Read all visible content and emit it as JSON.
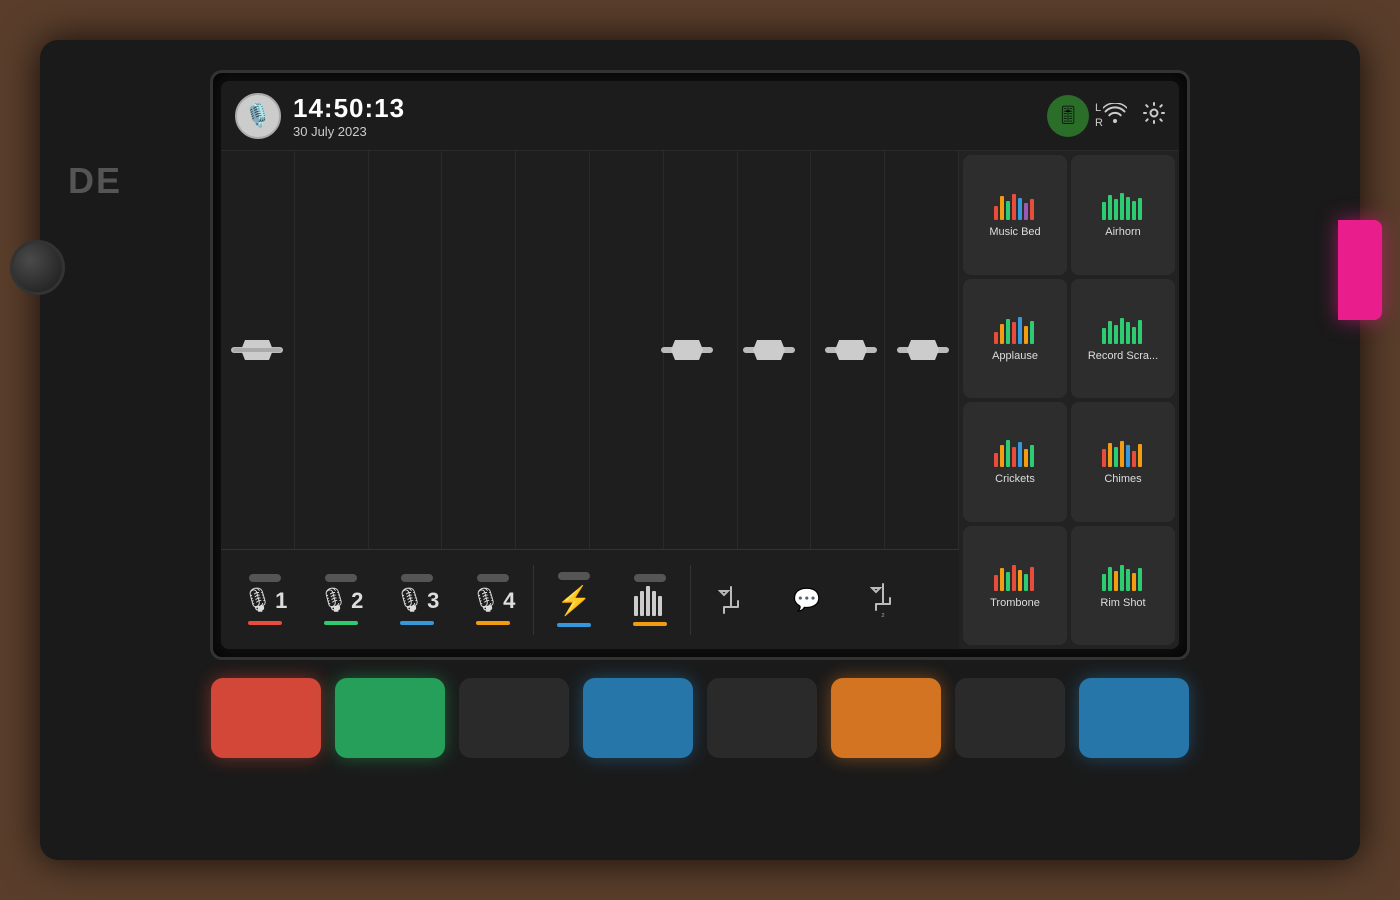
{
  "device": {
    "label": "DE"
  },
  "header": {
    "time": "14:50:13",
    "date": "30 July 2023",
    "avatar_emoji": "🎙️",
    "meter_icon": "🎚️",
    "lr_label": "L\nR",
    "wifi_icon": "wifi",
    "settings_icon": "gear"
  },
  "pads": [
    {
      "id": "music-bed",
      "label": "Music Bed",
      "colors": [
        "#e74c3c",
        "#f39c12",
        "#2ecc71",
        "#e74c3c",
        "#3498db",
        "#9b59b6"
      ]
    },
    {
      "id": "airhorn",
      "label": "Airhorn",
      "colors": [
        "#2ecc71",
        "#2ecc71",
        "#2ecc71",
        "#2ecc71",
        "#2ecc71",
        "#2ecc71"
      ]
    },
    {
      "id": "applause",
      "label": "Applause",
      "colors": [
        "#e74c3c",
        "#f39c12",
        "#2ecc71",
        "#e74c3c",
        "#3498db",
        "#f39c12"
      ]
    },
    {
      "id": "record-scratch",
      "label": "Record Scra...",
      "colors": [
        "#2ecc71",
        "#2ecc71",
        "#2ecc71",
        "#2ecc71",
        "#2ecc71",
        "#2ecc71"
      ]
    },
    {
      "id": "crickets",
      "label": "Crickets",
      "colors": [
        "#e74c3c",
        "#f39c12",
        "#2ecc71",
        "#e74c3c",
        "#3498db",
        "#f39c12"
      ]
    },
    {
      "id": "chimes",
      "label": "Chimes",
      "colors": [
        "#e74c3c",
        "#f39c12",
        "#2ecc71",
        "#f39c12",
        "#3498db",
        "#e74c3c"
      ]
    },
    {
      "id": "trombone",
      "label": "Trombone",
      "colors": [
        "#e74c3c",
        "#f39c12",
        "#2ecc71",
        "#e74c3c",
        "#f39c12",
        "#2ecc71"
      ]
    },
    {
      "id": "rim-shot",
      "label": "Rim Shot",
      "colors": [
        "#2ecc71",
        "#2ecc71",
        "#f39c12",
        "#2ecc71",
        "#2ecc71",
        "#f39c12"
      ]
    }
  ],
  "pad_bar_heights": [
    [
      8,
      14,
      22,
      18,
      12,
      24,
      16,
      10
    ],
    [
      20,
      12,
      8,
      18,
      24,
      10,
      16,
      14
    ],
    [
      10,
      18,
      24,
      14,
      8,
      22,
      12,
      20
    ],
    [
      16,
      8,
      20,
      24,
      12,
      18,
      10,
      22
    ],
    [
      12,
      24,
      16,
      8,
      22,
      14,
      20,
      10
    ],
    [
      18,
      10,
      22,
      16,
      24,
      8,
      14,
      20
    ],
    [
      14,
      20,
      10,
      22,
      16,
      24,
      8,
      18
    ],
    [
      22,
      16,
      8,
      20,
      10,
      18,
      24,
      12
    ]
  ],
  "channels": [
    {
      "id": "mic1",
      "icon": "🎙",
      "number": "1",
      "color": "#e74c3c",
      "has_indicator": true
    },
    {
      "id": "mic2",
      "icon": "🎙",
      "number": "2",
      "color": "#2ecc71",
      "has_indicator": true
    },
    {
      "id": "mic3",
      "icon": "🎙",
      "number": "3",
      "color": "#3498db",
      "has_indicator": true
    },
    {
      "id": "mic4",
      "icon": "🎙",
      "number": "4",
      "color": "#f39c12",
      "has_indicator": true
    },
    {
      "id": "bt",
      "icon": "⚡",
      "number": "",
      "color": "#3498db",
      "has_indicator": false
    },
    {
      "id": "meter",
      "icon": "📊",
      "number": "",
      "color": "#f39c12",
      "has_indicator": false
    }
  ],
  "usb_channels": [
    {
      "id": "usb1",
      "icon": "⬡"
    },
    {
      "id": "usb2",
      "icon": "⬡"
    },
    {
      "id": "usb3",
      "icon": "⬡"
    }
  ],
  "bottom_buttons": [
    {
      "id": "btn1",
      "color": "red"
    },
    {
      "id": "btn2",
      "color": "green"
    },
    {
      "id": "btn3",
      "color": "dark"
    },
    {
      "id": "btn4",
      "color": "blue"
    },
    {
      "id": "btn5",
      "color": "dark"
    },
    {
      "id": "btn6",
      "color": "orange"
    },
    {
      "id": "btn7",
      "color": "dark"
    },
    {
      "id": "btn8",
      "color": "blue"
    }
  ]
}
